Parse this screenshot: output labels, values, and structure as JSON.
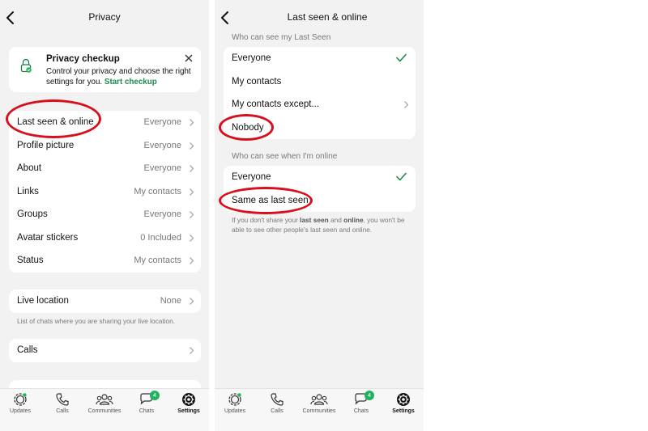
{
  "left": {
    "header": {
      "title": "Privacy"
    },
    "checkup": {
      "title": "Privacy checkup",
      "description": "Control your privacy and choose the right settings for you.",
      "link": "Start checkup"
    },
    "privacy_rows": [
      {
        "label": "Last seen & online",
        "value": "Everyone"
      },
      {
        "label": "Profile picture",
        "value": "Everyone"
      },
      {
        "label": "About",
        "value": "Everyone"
      },
      {
        "label": "Links",
        "value": "My contacts"
      },
      {
        "label": "Groups",
        "value": "Everyone"
      },
      {
        "label": "Avatar stickers",
        "value": "0 Included"
      },
      {
        "label": "Status",
        "value": "My contacts"
      }
    ],
    "live_location": {
      "label": "Live location",
      "value": "None",
      "footnote": "List of chats where you are sharing your live location."
    },
    "calls": {
      "label": "Calls"
    }
  },
  "right": {
    "header": {
      "title": "Last seen & online"
    },
    "last_seen": {
      "section_title": "Who can see my Last Seen",
      "options": [
        "Everyone",
        "My contacts",
        "My contacts except...",
        "Nobody"
      ],
      "selected": "Everyone"
    },
    "online": {
      "section_title": "Who can see when I'm online",
      "options": [
        "Everyone",
        "Same as last seen"
      ],
      "selected": "Everyone"
    },
    "footnote": {
      "part1": "If you don't share your ",
      "bold1": "last seen",
      "part2": " and ",
      "bold2": "online",
      "part3": ", you won't be able to see other people's last seen and online."
    }
  },
  "tabbar": {
    "tabs": [
      "Updates",
      "Calls",
      "Communities",
      "Chats",
      "Settings"
    ],
    "active": "Settings",
    "chats_badge": "4"
  },
  "colors": {
    "accent": "#1a8a4d",
    "badge": "#22b35e",
    "annotation": "#d8101c",
    "background": "#f2f2f2"
  }
}
